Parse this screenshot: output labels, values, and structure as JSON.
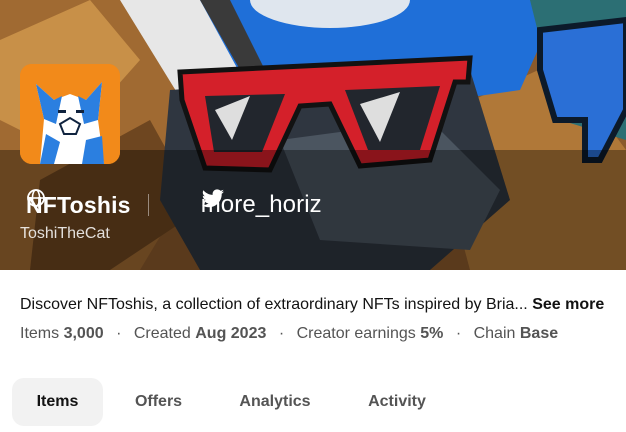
{
  "collection": {
    "name": "NFToshis",
    "creator": "ToshiTheCat",
    "more_label": "more_horiz",
    "description": "Discover NFToshis, a collection of extraordinary NFTs inspired by Bria...",
    "see_more_label": "See more"
  },
  "stats": [
    {
      "label": "Items",
      "value": "3,000"
    },
    {
      "label": "Created",
      "value": "Aug 2023"
    },
    {
      "label": "Creator earnings",
      "value": "5%"
    },
    {
      "label": "Chain",
      "value": "Base"
    }
  ],
  "separator": "·",
  "tabs": [
    {
      "label": "Items",
      "active": true
    },
    {
      "label": "Offers",
      "active": false
    },
    {
      "label": "Analytics",
      "active": false
    },
    {
      "label": "Activity",
      "active": false
    }
  ],
  "icons": {
    "website": "globe-icon",
    "twitter": "twitter-icon"
  },
  "colors": {
    "avatar_bg": "#f28a1a",
    "glasses": "#d4202a",
    "active_tab_bg": "#f2f2f2",
    "text_primary": "#121212",
    "text_secondary": "#545454"
  }
}
